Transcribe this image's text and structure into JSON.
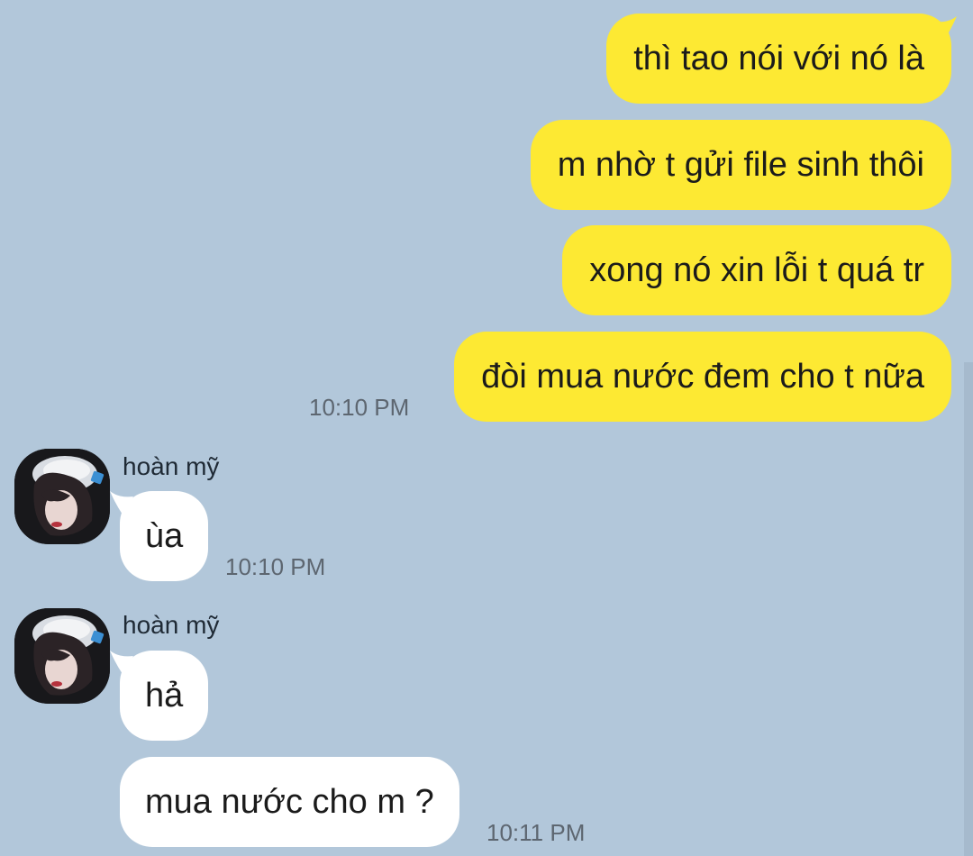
{
  "outgoing": [
    {
      "text": "thì tao nói với nó là"
    },
    {
      "text": "m nhờ t gửi file sinh thôi"
    },
    {
      "text": "xong nó xin lỗi t quá tr"
    },
    {
      "text": "đòi mua nước đem cho t nữa"
    }
  ],
  "outgoing_time": "10:10 PM",
  "incoming_groups": [
    {
      "sender": "hoàn mỹ",
      "messages": [
        {
          "text": "ùa"
        }
      ],
      "time": "10:10 PM"
    },
    {
      "sender": "hoàn mỹ",
      "messages": [
        {
          "text": "hả"
        },
        {
          "text": "mua nước cho m ?"
        }
      ],
      "time": "10:11 PM"
    }
  ],
  "colors": {
    "background": "#b2c7da",
    "outgoing_bubble": "#fde933",
    "incoming_bubble": "#ffffff",
    "timestamp": "#5d6670"
  }
}
